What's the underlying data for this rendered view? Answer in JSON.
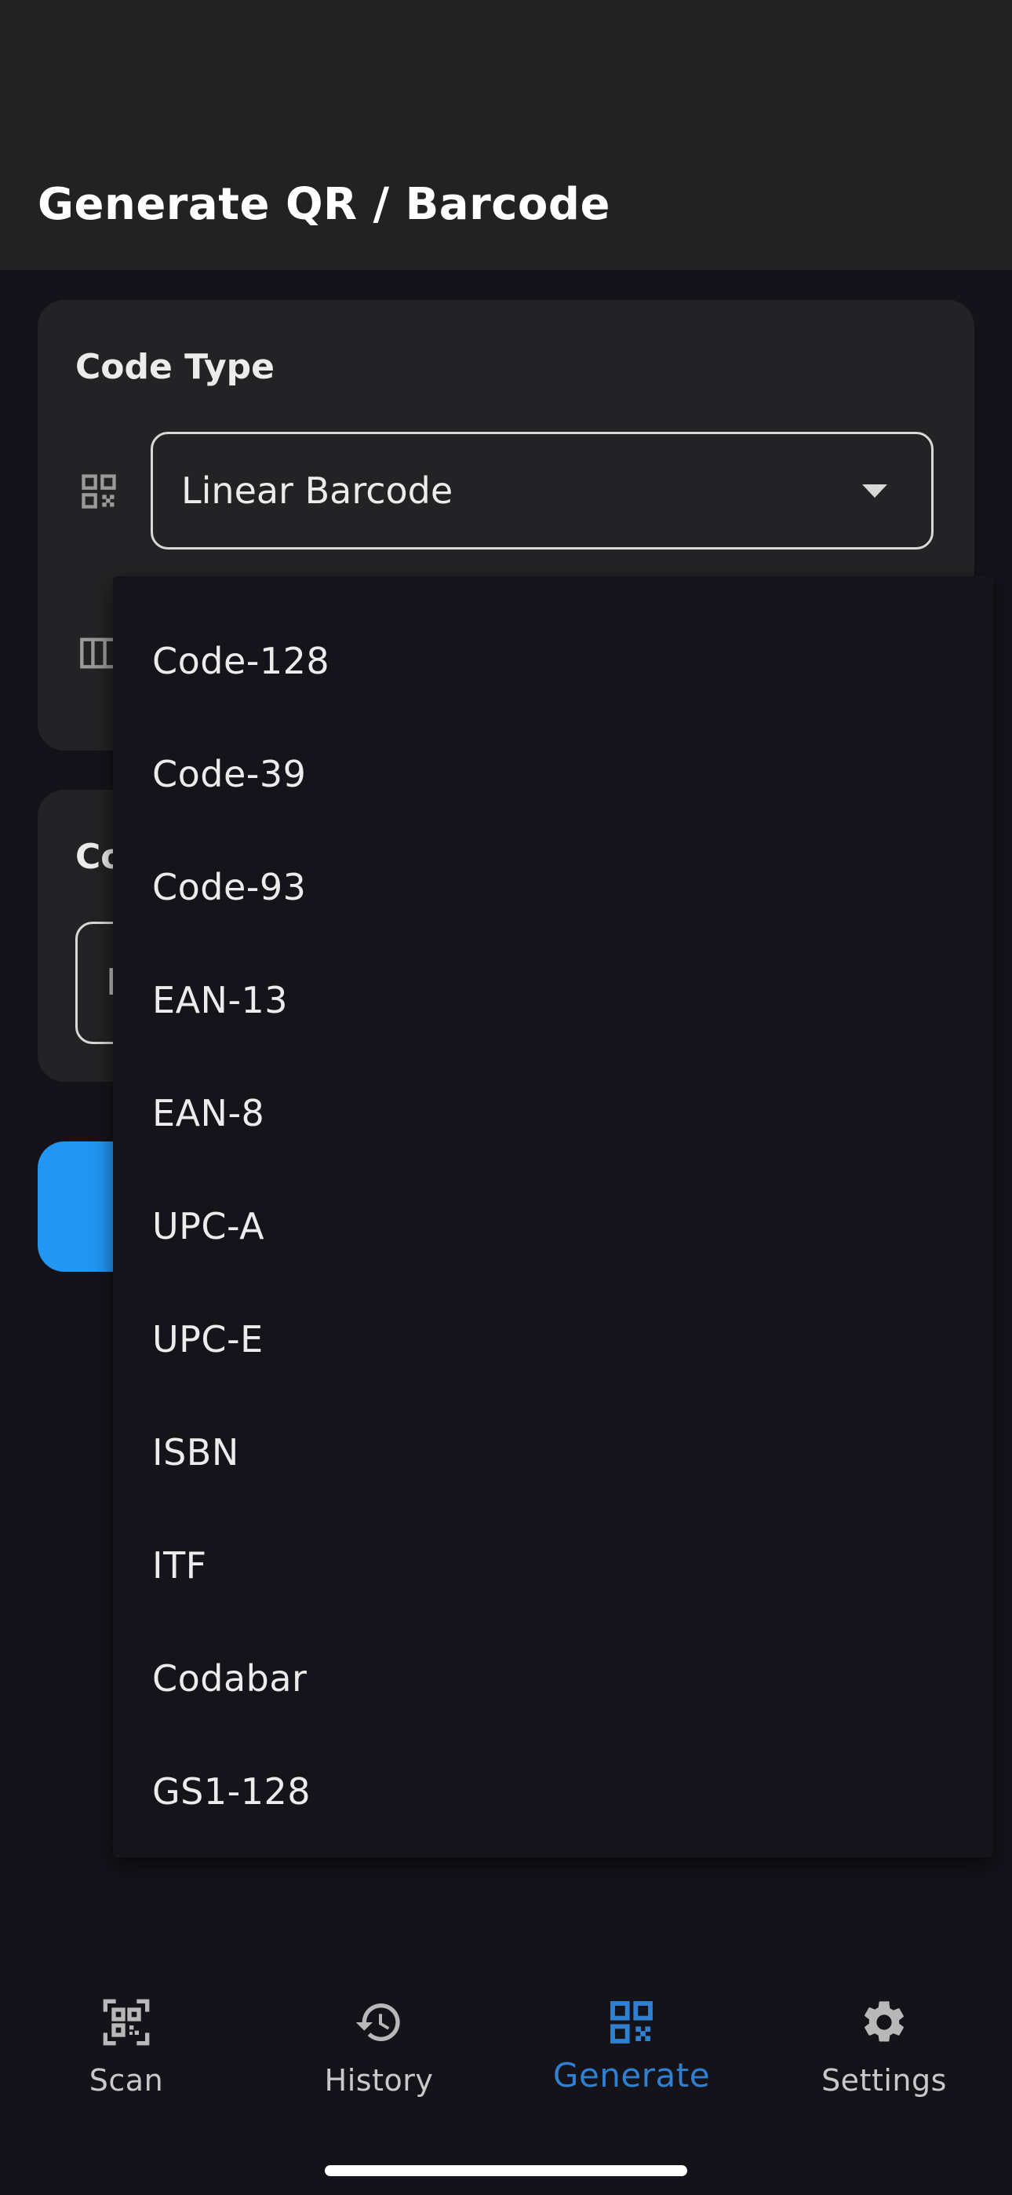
{
  "app_bar": {
    "title": "Generate QR / Barcode"
  },
  "code_type_card": {
    "title": "Code Type",
    "selected": "Linear Barcode"
  },
  "content_card": {
    "title": "Co",
    "input_hint": "E"
  },
  "dropdown": {
    "options": [
      "Code-128",
      "Code-39",
      "Code-93",
      "EAN-13",
      "EAN-8",
      "UPC-A",
      "UPC-E",
      "ISBN",
      "ITF",
      "Codabar",
      "GS1-128"
    ]
  },
  "bottom_nav": {
    "items": [
      {
        "label": "Scan",
        "icon": "qr-scan-icon"
      },
      {
        "label": "History",
        "icon": "history-icon"
      },
      {
        "label": "Generate",
        "icon": "qr-code-icon",
        "active": true
      },
      {
        "label": "Settings",
        "icon": "gear-icon"
      }
    ]
  },
  "colors": {
    "accent": "#2196f3",
    "nav_active": "#2f80d0",
    "surface": "#232325",
    "background": "#14131a"
  }
}
